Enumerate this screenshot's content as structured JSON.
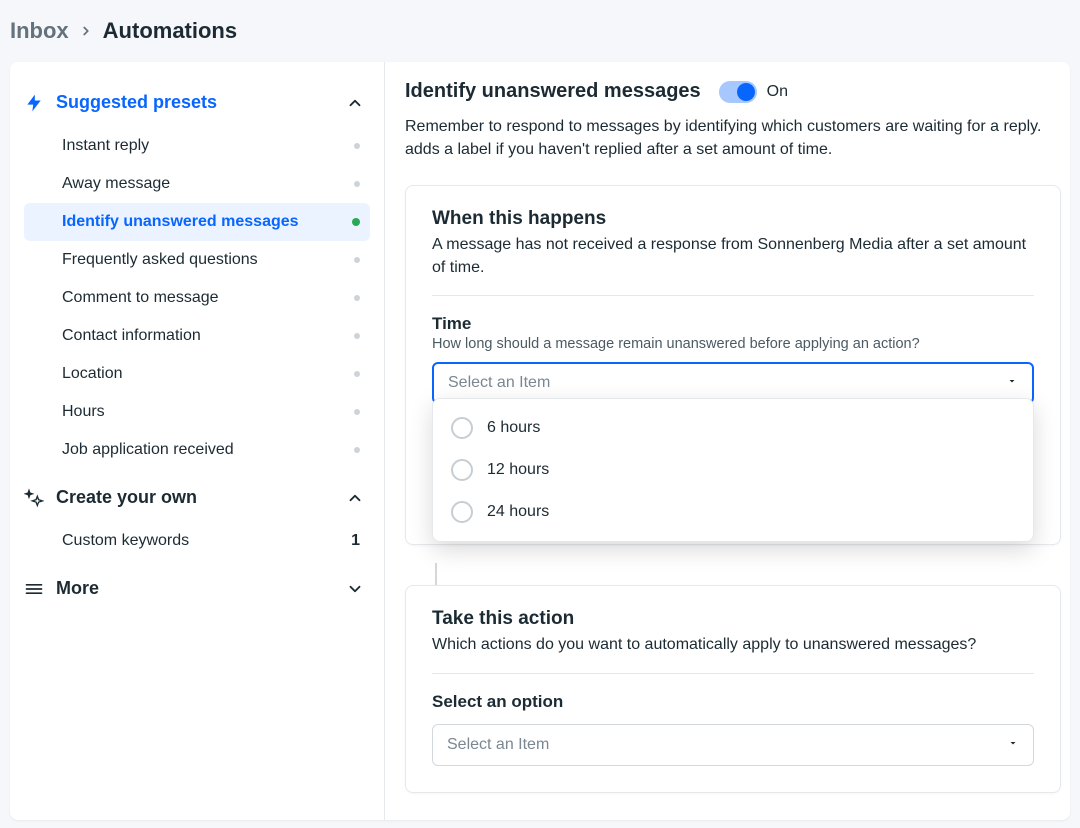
{
  "breadcrumb": {
    "parent": "Inbox",
    "current": "Automations"
  },
  "sidebar": {
    "presets_title": "Suggested presets",
    "presets": [
      {
        "label": "Instant reply"
      },
      {
        "label": "Away message"
      },
      {
        "label": "Identify unanswered messages"
      },
      {
        "label": "Frequently asked questions"
      },
      {
        "label": "Comment to message"
      },
      {
        "label": "Contact information"
      },
      {
        "label": "Location"
      },
      {
        "label": "Hours"
      },
      {
        "label": "Job application received"
      }
    ],
    "create_title": "Create your own",
    "custom": [
      {
        "label": "Custom keywords",
        "count": "1"
      }
    ],
    "more_title": "More"
  },
  "main": {
    "title": "Identify unanswered messages",
    "toggle_state": "On",
    "description": "Remember to respond to messages by identifying which customers are waiting for a reply. adds a label if you haven't replied after a set amount of time.",
    "card1": {
      "title": "When this happens",
      "sub": "A message has not received a response from Sonnenberg Media after a set amount of time.",
      "time_label": "Time",
      "time_help": "How long should a message remain unanswered before applying an action?",
      "select_placeholder": "Select an Item",
      "options": [
        {
          "label": "6 hours"
        },
        {
          "label": "12 hours"
        },
        {
          "label": "24 hours"
        }
      ]
    },
    "card2": {
      "title": "Take this action",
      "sub": "Which actions do you want to automatically apply to unanswered messages?",
      "option_label": "Select an option",
      "select_placeholder": "Select an Item"
    }
  }
}
